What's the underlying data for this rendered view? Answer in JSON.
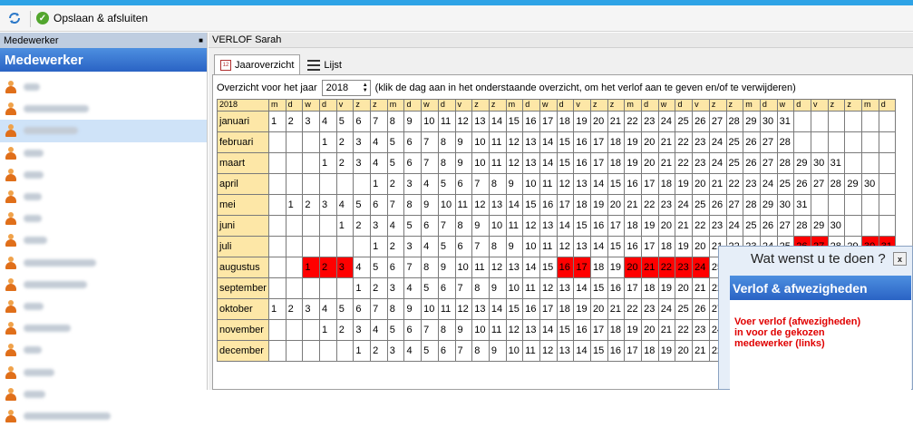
{
  "toolbar": {
    "save_label": "Opslaan & afsluiten"
  },
  "left": {
    "header": "Medewerker",
    "pin": "█",
    "title": "Medewerker",
    "employees": [
      {
        "w": 18
      },
      {
        "w": 72
      },
      {
        "w": 60,
        "selected": true
      },
      {
        "w": 22
      },
      {
        "w": 22
      },
      {
        "w": 20
      },
      {
        "w": 20
      },
      {
        "w": 26
      },
      {
        "w": 80
      },
      {
        "w": 70
      },
      {
        "w": 22
      },
      {
        "w": 52
      },
      {
        "w": 20
      },
      {
        "w": 34
      },
      {
        "w": 24
      },
      {
        "w": 96
      }
    ]
  },
  "right": {
    "header": "VERLOF Sarah",
    "tabs": [
      {
        "label": "Jaaroverzicht"
      },
      {
        "label": "Lijst"
      }
    ],
    "year_label": "Overzicht voor het jaar",
    "year": "2018",
    "hint": "(klik de dag aan in het onderstaande overzicht, om het verlof aan te geven en/of te verwijderen)"
  },
  "calendar": {
    "corner": "2018",
    "weekday_header": [
      "m",
      "d",
      "w",
      "d",
      "v",
      "z",
      "z",
      "m",
      "d",
      "w",
      "d",
      "v",
      "z",
      "z",
      "m",
      "d",
      "w",
      "d",
      "v",
      "z",
      "z",
      "m",
      "d",
      "w",
      "d",
      "v",
      "z",
      "z",
      "m",
      "d",
      "w",
      "d",
      "v",
      "z",
      "z",
      "m",
      "d"
    ],
    "months": [
      {
        "name": "januari",
        "offset": 0,
        "days": 31,
        "off": []
      },
      {
        "name": "februari",
        "offset": 3,
        "days": 28,
        "off": []
      },
      {
        "name": "maart",
        "offset": 3,
        "days": 31,
        "off": []
      },
      {
        "name": "april",
        "offset": 6,
        "days": 30,
        "off": []
      },
      {
        "name": "mei",
        "offset": 1,
        "days": 31,
        "off": []
      },
      {
        "name": "juni",
        "offset": 4,
        "days": 30,
        "off": []
      },
      {
        "name": "juli",
        "offset": 6,
        "days": 31,
        "off": [
          26,
          27,
          30,
          31
        ]
      },
      {
        "name": "augustus",
        "offset": 2,
        "days": 31,
        "off": [
          1,
          2,
          3,
          16,
          17,
          20,
          21,
          22,
          23,
          24
        ]
      },
      {
        "name": "september",
        "offset": 5,
        "days": 30,
        "off": []
      },
      {
        "name": "oktober",
        "offset": 0,
        "days": 31,
        "off": []
      },
      {
        "name": "november",
        "offset": 3,
        "days": 30,
        "off": []
      },
      {
        "name": "december",
        "offset": 5,
        "days": 31,
        "off": []
      }
    ]
  },
  "popup": {
    "title": "Wat wenst u te doen ?",
    "close": "x",
    "header": "Verlof & afwezigheden",
    "text": "Voer verlof (afwezigheden) in voor de gekozen medewerker (links)"
  }
}
